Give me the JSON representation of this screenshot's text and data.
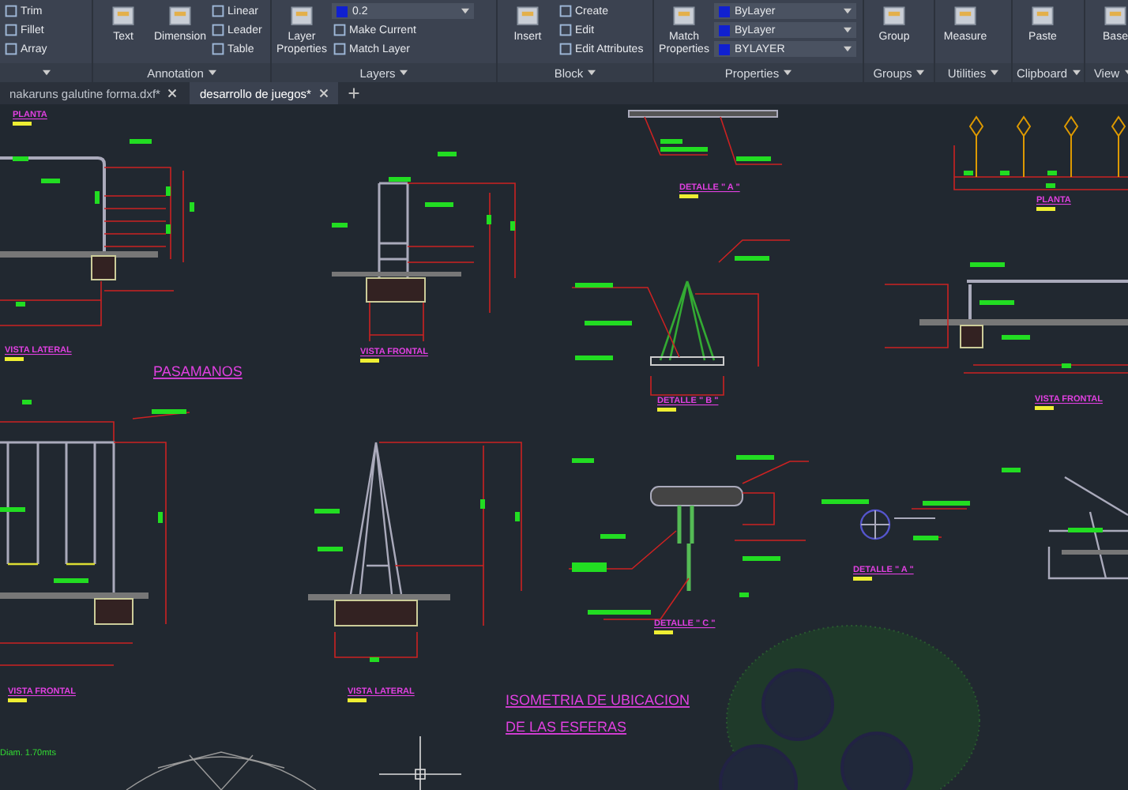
{
  "ribbon": {
    "panels": [
      {
        "items": [
          {
            "kind": "small",
            "label": "Trim"
          },
          {
            "kind": "small",
            "label": "Fillet"
          },
          {
            "kind": "small",
            "label": "Array"
          }
        ]
      },
      {
        "title": "Annotation",
        "items": [
          {
            "kind": "big",
            "label": "Text"
          },
          {
            "kind": "big",
            "label": "Dimension"
          },
          {
            "kind": "small",
            "label": "Linear"
          },
          {
            "kind": "small",
            "label": "Leader"
          },
          {
            "kind": "small",
            "label": "Table"
          }
        ]
      },
      {
        "title": "Layers",
        "items": [
          {
            "kind": "big",
            "label": "Layer Properties"
          },
          {
            "kind": "dropdown",
            "label": "0.2"
          },
          {
            "kind": "small",
            "label": "Make Current"
          },
          {
            "kind": "small",
            "label": "Match Layer"
          }
        ]
      },
      {
        "title": "Block",
        "items": [
          {
            "kind": "big",
            "label": "Insert"
          },
          {
            "kind": "small",
            "label": "Create"
          },
          {
            "kind": "small",
            "label": "Edit"
          },
          {
            "kind": "small",
            "label": "Edit Attributes"
          }
        ]
      },
      {
        "title": "Properties",
        "items": [
          {
            "kind": "big",
            "label": "Match Properties"
          },
          {
            "kind": "dropdown",
            "label": "ByLayer"
          },
          {
            "kind": "dropdown",
            "label": "ByLayer"
          },
          {
            "kind": "dropdown",
            "label": "BYLAYER"
          }
        ]
      },
      {
        "title": "Groups",
        "items": [
          {
            "kind": "big",
            "label": "Group"
          }
        ]
      },
      {
        "title": "Utilities",
        "items": [
          {
            "kind": "big",
            "label": "Measure"
          }
        ]
      },
      {
        "title": "Clipboard",
        "items": [
          {
            "kind": "big",
            "label": "Paste"
          }
        ]
      },
      {
        "title": "View",
        "items": [
          {
            "kind": "big",
            "label": "Base"
          }
        ]
      }
    ]
  },
  "document_tabs": [
    {
      "label": "nakaruns galutine forma.dxf*",
      "selected": false
    },
    {
      "label": "desarrollo de juegos*",
      "selected": true
    }
  ],
  "drawing_labels": [
    {
      "kind": "label",
      "text": "PLANTA"
    },
    {
      "kind": "label",
      "text": "VISTA LATERAL"
    },
    {
      "kind": "title",
      "text": "PASAMANOS"
    },
    {
      "kind": "label",
      "text": "VISTA FRONTAL"
    },
    {
      "kind": "label",
      "text": "DETALLE \" A \""
    },
    {
      "kind": "label",
      "text": "PLANTA"
    },
    {
      "kind": "label",
      "text": "DETALLE \" B \""
    },
    {
      "kind": "label",
      "text": "VISTA FRONTAL"
    },
    {
      "kind": "label",
      "text": "VISTA FRONTAL"
    },
    {
      "kind": "label",
      "text": "VISTA LATERAL"
    },
    {
      "kind": "label",
      "text": "DETALLE \" C \""
    },
    {
      "kind": "label",
      "text": "DETALLE \" A \""
    },
    {
      "kind": "title",
      "text": "ISOMETRIA DE UBICACION"
    },
    {
      "kind": "title",
      "text": "DE LAS ESFERAS"
    },
    {
      "kind": "note",
      "text": "Diam. 1.70mts"
    }
  ]
}
